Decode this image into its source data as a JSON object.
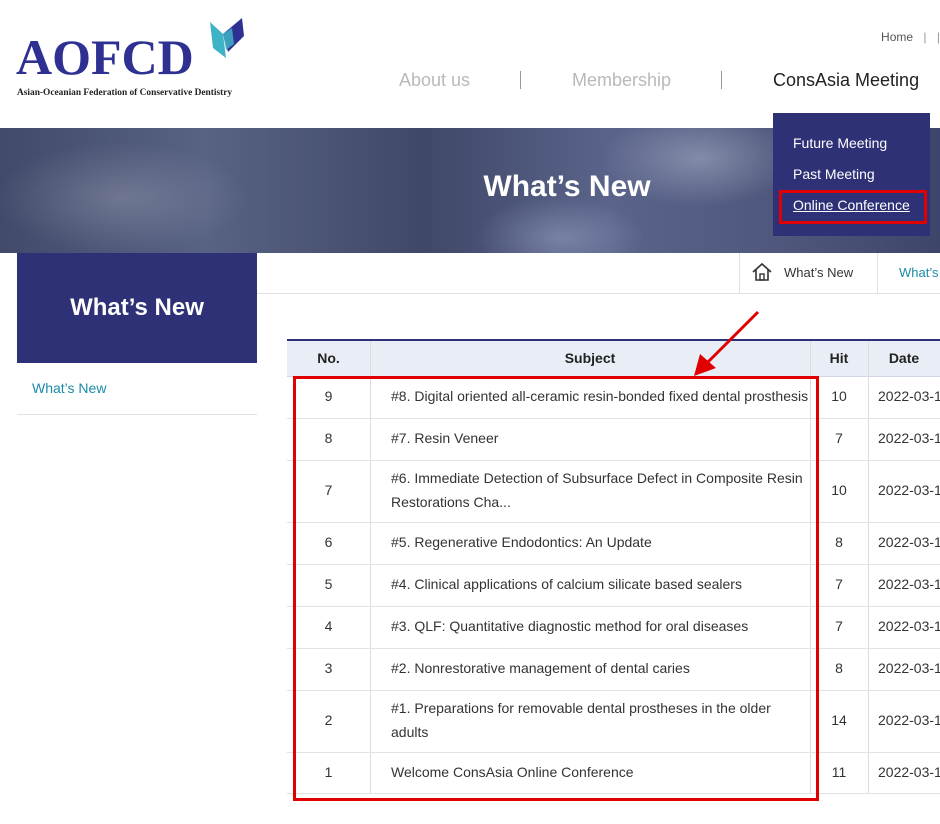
{
  "header": {
    "logo_text": "AOFCD",
    "logo_subtitle": "Asian-Oceanian Federation of Conservative Dentistry",
    "util_links": [
      "Home"
    ],
    "nav": [
      "About us",
      "Membership",
      "ConsAsia Meeting"
    ],
    "nav_active": "ConsAsia Meeting",
    "brand_color": "#2e3176",
    "logo_mark_colors": [
      "#3fb3c6",
      "#2e3192"
    ]
  },
  "banner": {
    "title": "What’s New"
  },
  "dropdown": {
    "items": [
      "Future Meeting",
      "Past Meeting",
      "Online Conference"
    ],
    "highlighted": "Online Conference"
  },
  "sidebar": {
    "title": "What’s New",
    "items": [
      "What’s New"
    ]
  },
  "breadcrumb": {
    "home_icon": "home-icon",
    "items": [
      "What’s New",
      "What’s"
    ]
  },
  "table": {
    "columns": [
      "No.",
      "Subject",
      "Hit",
      "Date"
    ],
    "rows": [
      {
        "no": "9",
        "subject": "#8. Digital oriented all-ceramic resin-bonded fixed dental prosthesis",
        "hit": "10",
        "date": "2022-03-1"
      },
      {
        "no": "8",
        "subject": "#7. Resin Veneer",
        "hit": "7",
        "date": "2022-03-1"
      },
      {
        "no": "7",
        "subject": "#6. Immediate Detection of Subsurface Defect in Composite Resin Restorations Cha...",
        "hit": "10",
        "date": "2022-03-1"
      },
      {
        "no": "6",
        "subject": "#5. Regenerative Endodontics: An Update",
        "hit": "8",
        "date": "2022-03-1"
      },
      {
        "no": "5",
        "subject": "#4. Clinical applications of calcium silicate based sealers",
        "hit": "7",
        "date": "2022-03-1"
      },
      {
        "no": "4",
        "subject": "#3. QLF: Quantitative diagnostic method for oral diseases",
        "hit": "7",
        "date": "2022-03-1"
      },
      {
        "no": "3",
        "subject": "#2. Nonrestorative management of dental caries",
        "hit": "8",
        "date": "2022-03-1"
      },
      {
        "no": "2",
        "subject": "#1. Preparations for removable dental prostheses in the older adults",
        "hit": "14",
        "date": "2022-03-1"
      },
      {
        "no": "1",
        "subject": "Welcome ConsAsia Online Conference",
        "hit": "11",
        "date": "2022-03-1"
      }
    ]
  },
  "annotation_color": "#e00000"
}
